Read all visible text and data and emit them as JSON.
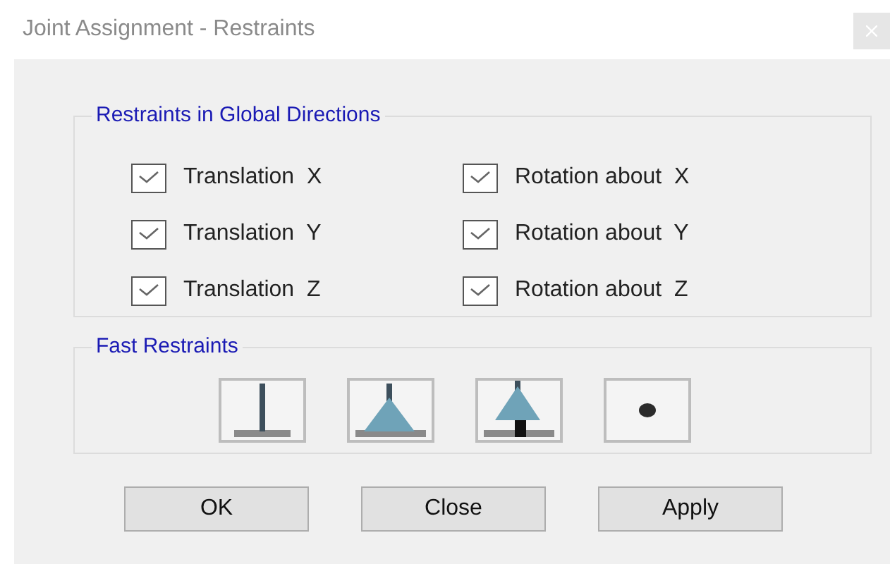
{
  "window": {
    "title": "Joint Assignment - Restraints"
  },
  "global_directions": {
    "title": "Restraints in Global Directions",
    "items": [
      {
        "label": "Translation  X",
        "checked": true
      },
      {
        "label": "Rotation about  X",
        "checked": true
      },
      {
        "label": "Translation  Y",
        "checked": true
      },
      {
        "label": "Rotation about  Y",
        "checked": true
      },
      {
        "label": "Translation  Z",
        "checked": true
      },
      {
        "label": "Rotation about  Z",
        "checked": true
      }
    ]
  },
  "fast_restraints": {
    "title": "Fast Restraints",
    "buttons": [
      {
        "kind": "fixed"
      },
      {
        "kind": "pinned"
      },
      {
        "kind": "roller"
      },
      {
        "kind": "free"
      }
    ]
  },
  "buttons": [
    "OK",
    "Close",
    "Apply"
  ]
}
